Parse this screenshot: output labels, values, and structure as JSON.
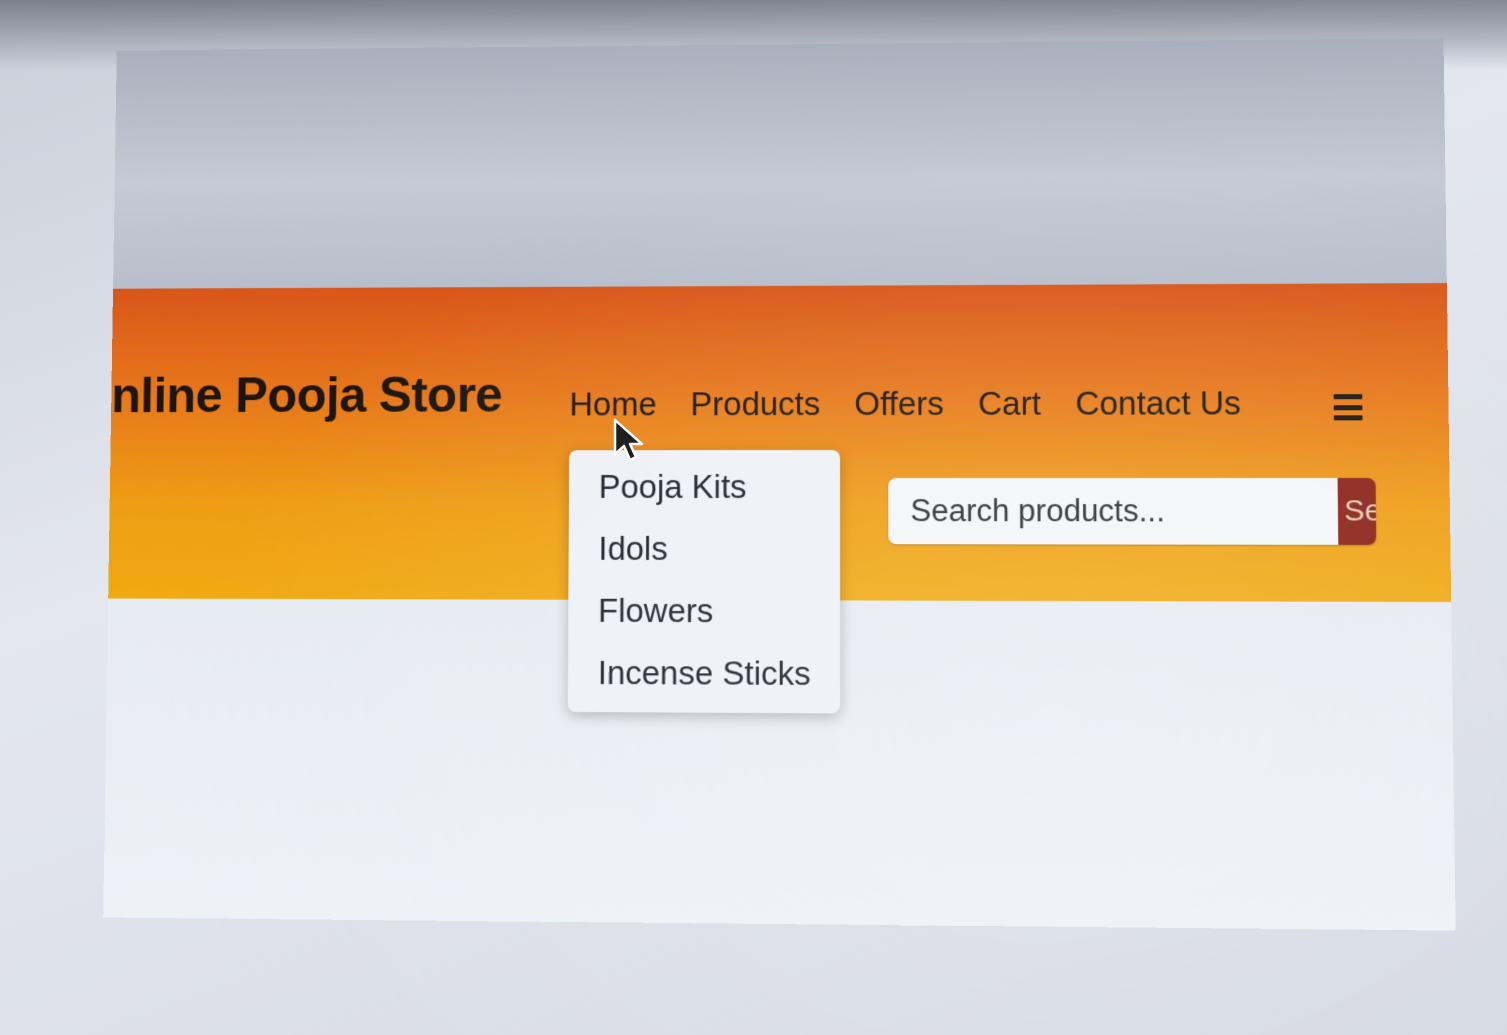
{
  "brand": {
    "name": "nline Pooja Store"
  },
  "nav": {
    "items": [
      "Home",
      "Products",
      "Offers",
      "Cart",
      "Contact Us"
    ],
    "menu_icon": "hamburger-menu-icon"
  },
  "dropdown": {
    "items": [
      "Pooja Kits",
      "Idols",
      "Flowers",
      "Incense Sticks"
    ]
  },
  "search": {
    "placeholder": "Search products...",
    "button_label": "Search"
  },
  "colors": {
    "header_top": "#d9561a",
    "header_bottom": "#f0aa12",
    "search_button": "#8a1f14"
  }
}
